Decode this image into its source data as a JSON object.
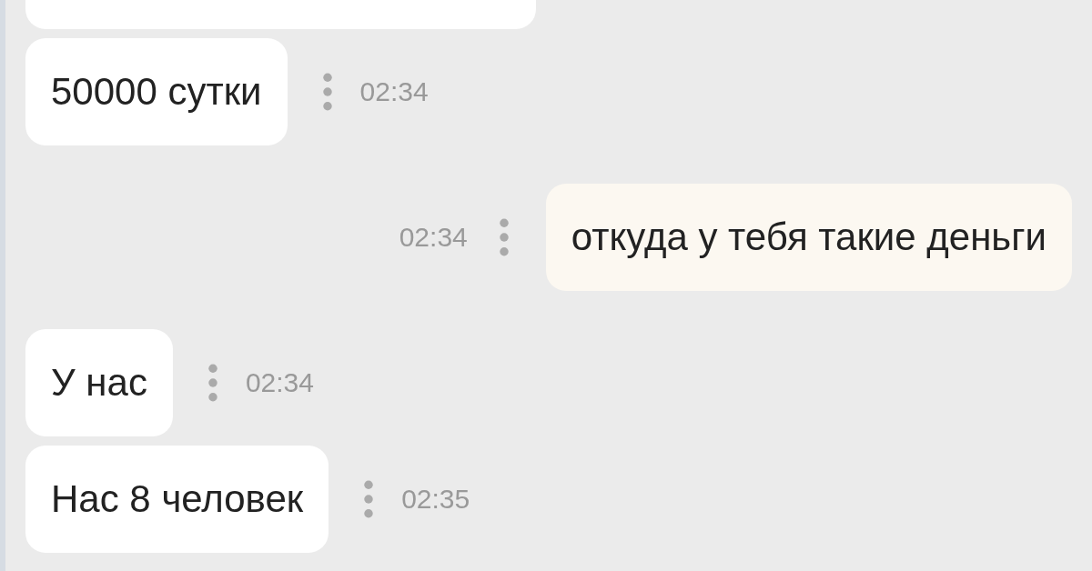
{
  "messages": [
    {
      "kind": "incoming",
      "cut": true
    },
    {
      "kind": "incoming",
      "text": "50000 сутки",
      "time": "02:34"
    },
    {
      "kind": "outgoing",
      "text": "откуда у тебя такие деньги",
      "time": "02:34"
    },
    {
      "kind": "incoming",
      "text": "У нас",
      "time": "02:34"
    },
    {
      "kind": "incoming",
      "text": "Нас 8 человек",
      "time": "02:35"
    }
  ]
}
